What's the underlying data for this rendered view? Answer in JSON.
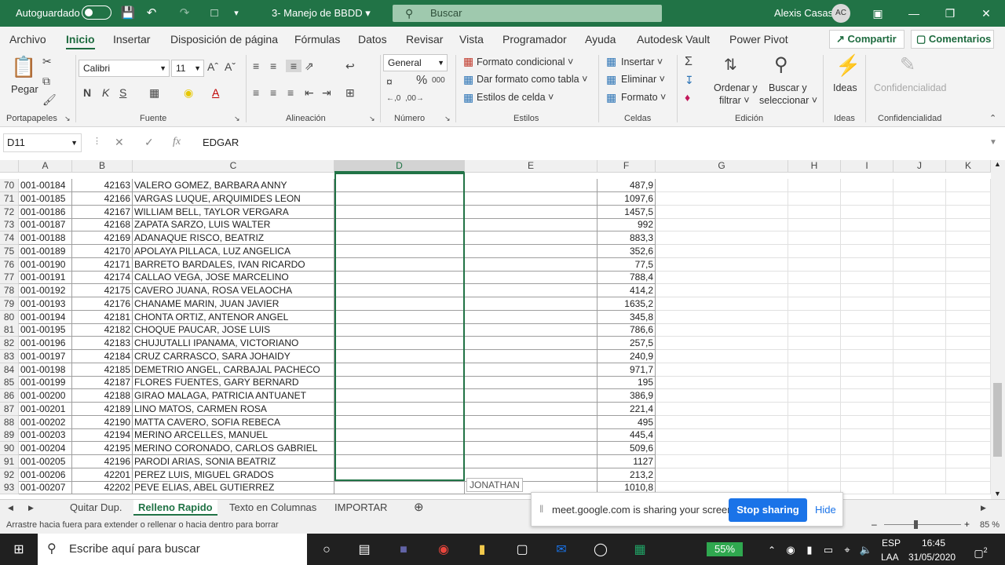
{
  "titlebar": {
    "autosave": "Autoguardado",
    "filename": "3- Manejo de BBDD",
    "search_placeholder": "Buscar",
    "user": "Alexis Casas",
    "initials": "AC"
  },
  "menu": [
    "Archivo",
    "Inicio",
    "Insertar",
    "Disposición de página",
    "Fórmulas",
    "Datos",
    "Revisar",
    "Vista",
    "Programador",
    "Ayuda",
    "Autodesk Vault",
    "Power Pivot"
  ],
  "share_label": "Compartir",
  "comments_label": "Comentarios",
  "ribbon": {
    "paste": "Pegar",
    "font_name": "Calibri",
    "font_size": "11",
    "number_format": "General",
    "cond_format": "Formato condicional",
    "table_format": "Dar formato como tabla",
    "cell_styles": "Estilos de celda",
    "insert": "Insertar",
    "delete": "Eliminar",
    "format": "Formato",
    "sort_filter_1": "Ordenar y",
    "sort_filter_2": "filtrar",
    "find_1": "Buscar y",
    "find_2": "seleccionar",
    "ideas": "Ideas",
    "confidentiality": "Confidencialidad",
    "groups": {
      "clipboard": "Portapapeles",
      "font": "Fuente",
      "alignment": "Alineación",
      "number": "Número",
      "styles": "Estilos",
      "cells": "Celdas",
      "editing": "Edición",
      "ideas": "Ideas",
      "confidentiality": "Confidencialidad"
    }
  },
  "formula_bar": {
    "name_box": "D11",
    "fx": "fx",
    "value": "EDGAR"
  },
  "columns": [
    "A",
    "B",
    "C",
    "D",
    "E",
    "F",
    "G",
    "H",
    "I",
    "J",
    "K"
  ],
  "rows": [
    {
      "n": "70",
      "a": "001-00184",
      "b": "42163",
      "c": "VALERO GOMEZ, BARBARA ANNY",
      "f": "487,9"
    },
    {
      "n": "71",
      "a": "001-00185",
      "b": "42166",
      "c": "VARGAS LUQUE, ARQUIMIDES LEON",
      "f": "1097,6"
    },
    {
      "n": "72",
      "a": "001-00186",
      "b": "42167",
      "c": "WILLIAM BELL, TAYLOR VERGARA",
      "f": "1457,5"
    },
    {
      "n": "73",
      "a": "001-00187",
      "b": "42168",
      "c": "ZAPATA SARZO, LUIS WALTER",
      "f": "992"
    },
    {
      "n": "74",
      "a": "001-00188",
      "b": "42169",
      "c": "ADANAQUE RISCO, BEATRIZ",
      "f": "883,3"
    },
    {
      "n": "75",
      "a": "001-00189",
      "b": "42170",
      "c": "APOLAYA PILLACA, LUZ ANGELICA",
      "f": "352,6"
    },
    {
      "n": "76",
      "a": "001-00190",
      "b": "42171",
      "c": "BARRETO BARDALES, IVAN RICARDO",
      "f": "77,5"
    },
    {
      "n": "77",
      "a": "001-00191",
      "b": "42174",
      "c": "CALLAO VEGA, JOSE MARCELINO",
      "f": "788,4"
    },
    {
      "n": "78",
      "a": "001-00192",
      "b": "42175",
      "c": "CAVERO JUANA, ROSA VELAOCHA",
      "f": "414,2"
    },
    {
      "n": "79",
      "a": "001-00193",
      "b": "42176",
      "c": "CHANAME MARIN, JUAN JAVIER",
      "f": "1635,2"
    },
    {
      "n": "80",
      "a": "001-00194",
      "b": "42181",
      "c": "CHONTA ORTIZ, ANTENOR ANGEL",
      "f": "345,8"
    },
    {
      "n": "81",
      "a": "001-00195",
      "b": "42182",
      "c": "CHOQUE PAUCAR, JOSE LUIS",
      "f": "786,6"
    },
    {
      "n": "82",
      "a": "001-00196",
      "b": "42183",
      "c": "CHUJUTALLI IPANAMA, VICTORIANO",
      "f": "257,5"
    },
    {
      "n": "83",
      "a": "001-00197",
      "b": "42184",
      "c": "CRUZ CARRASCO, SARA JOHAIDY",
      "f": "240,9"
    },
    {
      "n": "84",
      "a": "001-00198",
      "b": "42185",
      "c": "DEMETRIO ANGEL, CARBAJAL PACHECO",
      "f": "971,7"
    },
    {
      "n": "85",
      "a": "001-00199",
      "b": "42187",
      "c": "FLORES FUENTES, GARY BERNARD",
      "f": "195"
    },
    {
      "n": "86",
      "a": "001-00200",
      "b": "42188",
      "c": "GIRAO MALAGA, PATRICIA ANTUANET",
      "f": "386,9"
    },
    {
      "n": "87",
      "a": "001-00201",
      "b": "42189",
      "c": "LINO MATOS, CARMEN ROSA",
      "f": "221,4"
    },
    {
      "n": "88",
      "a": "001-00202",
      "b": "42190",
      "c": "MATTA CAVERO, SOFIA REBECA",
      "f": "495"
    },
    {
      "n": "89",
      "a": "001-00203",
      "b": "42194",
      "c": "MERINO ARCELLES, MANUEL",
      "f": "445,4"
    },
    {
      "n": "90",
      "a": "001-00204",
      "b": "42195",
      "c": "MERINO CORONADO, CARLOS GABRIEL",
      "f": "509,6"
    },
    {
      "n": "91",
      "a": "001-00205",
      "b": "42196",
      "c": "PARODI ARIAS, SONIA BEATRIZ",
      "f": "1127"
    },
    {
      "n": "92",
      "a": "001-00206",
      "b": "42201",
      "c": "PEREZ LUIS, MIGUEL GRADOS",
      "f": "213,2"
    },
    {
      "n": "93",
      "a": "001-00207",
      "b": "42202",
      "c": "PEVE ELIAS, ABEL GUTIERREZ",
      "f": "1010,8"
    }
  ],
  "flash_fill_hint": "JONATHAN",
  "sheets": [
    "Quitar Dup.",
    "Relleno Rapido",
    "Texto en Columnas",
    "IMPORTAR"
  ],
  "active_sheet": "Relleno Rapido",
  "status_message": "Arrastre hacia fuera para extender o rellenar o hacia dentro para borrar",
  "zoom": "85 %",
  "meet_popup": {
    "message": "meet.google.com is sharing your screen.",
    "stop": "Stop sharing",
    "hide": "Hide"
  },
  "taskbar": {
    "search_placeholder": "Escribe aquí para buscar",
    "battery": "55%",
    "lang_1": "ESP",
    "lang_2": "LAA",
    "time": "16:45",
    "date": "31/05/2020",
    "notifications": "2"
  },
  "colors": {
    "excel_green": "#217346",
    "selection_border": "#217346",
    "meet_blue": "#1a73e8"
  }
}
